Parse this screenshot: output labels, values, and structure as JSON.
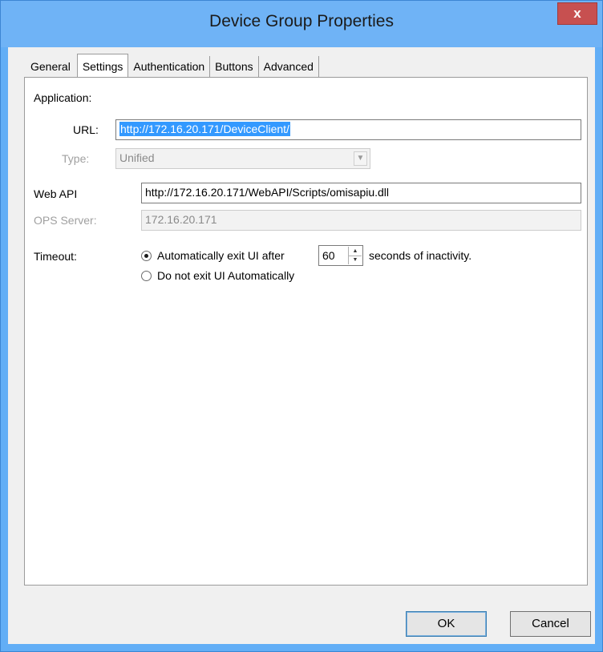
{
  "window": {
    "title": "Device Group Properties",
    "close_glyph": "x"
  },
  "tabs": [
    {
      "label": "General",
      "active": false
    },
    {
      "label": "Settings",
      "active": true
    },
    {
      "label": "Authentication",
      "active": false
    },
    {
      "label": "Buttons",
      "active": false
    },
    {
      "label": "Advanced",
      "active": false
    }
  ],
  "settings": {
    "application_label": "Application:",
    "url_label": "URL:",
    "url_value": "http://172.16.20.171/DeviceClient/",
    "type_label": "Type:",
    "type_value": "Unified",
    "webapi_label": "Web API",
    "webapi_value": "http://172.16.20.171/WebAPI/Scripts/omisapiu.dll",
    "ops_label": "OPS Server:",
    "ops_value": "172.16.20.171",
    "timeout_label": "Timeout:",
    "timeout_option_exit": "Automatically exit UI after",
    "timeout_value": "60",
    "timeout_suffix": "seconds of inactivity.",
    "timeout_option_never": "Do not exit UI Automatically",
    "timeout_selected": "exit"
  },
  "buttons": {
    "ok": "OK",
    "cancel": "Cancel"
  },
  "icons": {
    "close": "close-icon",
    "dropdown": "chevron-down-icon",
    "spin_up": "caret-up-icon",
    "spin_down": "caret-down-icon"
  },
  "colors": {
    "titlebar": "#6fb3f6",
    "close_button": "#c75050",
    "selection": "#3399ff"
  }
}
